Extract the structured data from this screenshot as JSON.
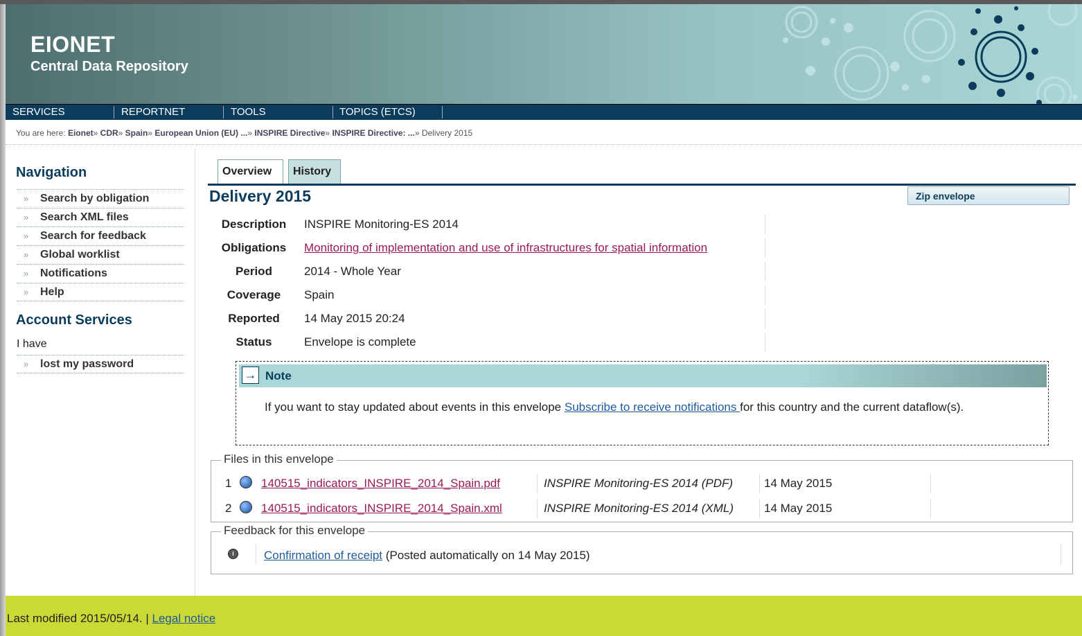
{
  "header": {
    "logo_main": "EIONET",
    "subtitle": "Central Data Repository"
  },
  "topnav": [
    "SERVICES",
    "REPORTNET",
    "TOOLS",
    "TOPICS (ETCS)"
  ],
  "breadcrumb": {
    "prefix": "You are here:",
    "items": [
      "Eionet",
      "CDR",
      "Spain",
      "European Union (EU) ...",
      "INSPIRE Directive",
      "INSPIRE Directive: ..."
    ],
    "current": "Delivery 2015"
  },
  "sidebar": {
    "nav_heading": "Navigation",
    "nav_items": [
      "Search by obligation",
      "Search XML files",
      "Search for feedback",
      "Global worklist",
      "Notifications",
      "Help"
    ],
    "account_heading": "Account Services",
    "account_text": "I have",
    "account_items": [
      "lost my password"
    ]
  },
  "tabs": [
    "Overview",
    "History"
  ],
  "page_title": "Delivery 2015",
  "zip_button": "Zip envelope",
  "details": [
    {
      "label": "Description",
      "value": "INSPIRE Monitoring-ES 2014",
      "link": false
    },
    {
      "label": "Obligations",
      "value": "Monitoring of implementation and use of infrastructures for spatial information",
      "link": true
    },
    {
      "label": "Period",
      "value": "2014 - Whole Year",
      "link": false
    },
    {
      "label": "Coverage",
      "value": "Spain",
      "link": false
    },
    {
      "label": "Reported",
      "value": "14 May 2015 20:24",
      "link": false
    },
    {
      "label": "Status",
      "value": "Envelope is complete",
      "link": false
    }
  ],
  "note": {
    "title": "Note",
    "text_before": "If you want to stay updated about events in this envelope ",
    "link": "Subscribe to receive notifications ",
    "text_after": "for this country and the current dataflow(s)."
  },
  "files": {
    "legend": "Files in this envelope",
    "rows": [
      {
        "num": "1",
        "name": "140515_indicators_INSPIRE_2014_Spain.pdf",
        "desc": "INSPIRE Monitoring-ES 2014 (PDF)",
        "date": "14 May 2015"
      },
      {
        "num": "2",
        "name": "140515_indicators_INSPIRE_2014_Spain.xml",
        "desc": "INSPIRE Monitoring-ES 2014 (XML)",
        "date": "14 May 2015"
      }
    ]
  },
  "feedback": {
    "legend": "Feedback for this envelope",
    "link": "Confirmation of receipt",
    "text": " (Posted automatically on 14 May 2015)"
  },
  "footer": {
    "text": "Last modified 2015/05/14. | ",
    "link": "Legal notice"
  },
  "colors": {
    "brand_dark": "#0c3c5c",
    "footer": "#cad936",
    "link_purple": "#9a1a58",
    "link_blue": "#1f5a99"
  }
}
